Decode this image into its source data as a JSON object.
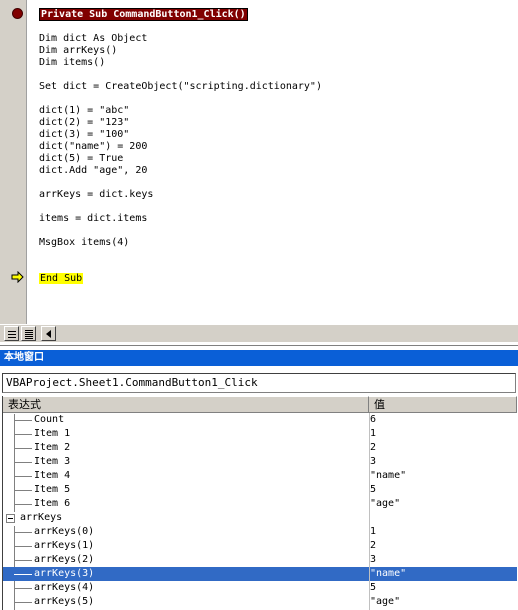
{
  "editor": {
    "lines": [
      "Private Sub CommandButton1_Click()",
      "Dim dict As Object",
      "Dim arrKeys()",
      "Dim items()",
      "Set dict = CreateObject(\"scripting.dictionary\")",
      "dict(1) = \"abc\"",
      "dict(2) = \"123\"",
      "dict(3) = \"100\"",
      "dict(\"name\") = 200",
      "dict(5) = True",
      "dict.Add \"age\", 20",
      "arrKeys = dict.keys",
      "items = dict.items",
      "MsgBox items(4)",
      "End Sub"
    ],
    "breakpoint_color": "#800000",
    "exec_highlight_color": "#ffff00"
  },
  "locals": {
    "title": "本地窗口",
    "context": "VBAProject.Sheet1.CommandButton1_Click",
    "columns": [
      "表达式",
      "值"
    ],
    "rows": [
      {
        "label": "Count",
        "value": "6"
      },
      {
        "label": "Item 1",
        "value": "1"
      },
      {
        "label": "Item 2",
        "value": "2"
      },
      {
        "label": "Item 3",
        "value": "3"
      },
      {
        "label": "Item 4",
        "value": "\"name\""
      },
      {
        "label": "Item 5",
        "value": "5"
      },
      {
        "label": "Item 6",
        "value": "\"age\""
      },
      {
        "label": "arrKeys",
        "value": ""
      },
      {
        "label": "arrKeys(0)",
        "value": "1"
      },
      {
        "label": "arrKeys(1)",
        "value": "2"
      },
      {
        "label": "arrKeys(2)",
        "value": "3"
      },
      {
        "label": "arrKeys(3)",
        "value": "\"name\""
      },
      {
        "label": "arrKeys(4)",
        "value": "5"
      },
      {
        "label": "arrKeys(5)",
        "value": "\"age\""
      }
    ],
    "selected_color": "#316ac5",
    "title_color": "#0a5fd7"
  }
}
